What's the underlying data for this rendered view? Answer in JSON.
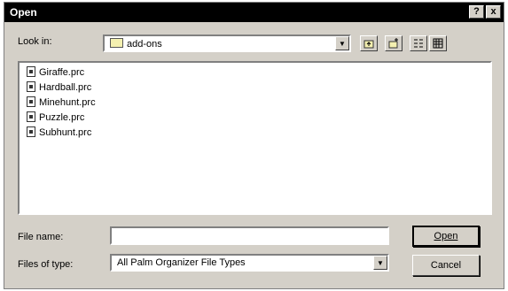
{
  "window": {
    "title": "Open",
    "help_glyph": "?",
    "close_glyph": "x"
  },
  "lookin": {
    "label": "Look in:",
    "value": "add-ons",
    "icon": "folder-icon"
  },
  "toolbar": {
    "buttons": [
      {
        "name": "up-one-level-button",
        "icon": "up-folder-icon"
      },
      {
        "name": "new-folder-button",
        "icon": "new-folder-icon"
      },
      {
        "name": "list-view-button",
        "icon": "list-view-icon"
      },
      {
        "name": "details-view-button",
        "icon": "details-view-icon"
      }
    ]
  },
  "files": [
    {
      "name": "Giraffe.prc"
    },
    {
      "name": "Hardball.prc"
    },
    {
      "name": "Minehunt.prc"
    },
    {
      "name": "Puzzle.prc"
    },
    {
      "name": "Subhunt.prc"
    }
  ],
  "filename": {
    "label": "File name:",
    "value": ""
  },
  "filetype": {
    "label": "Files of type:",
    "value": "All Palm Organizer File Types"
  },
  "buttons": {
    "open": "Open",
    "cancel": "Cancel"
  }
}
